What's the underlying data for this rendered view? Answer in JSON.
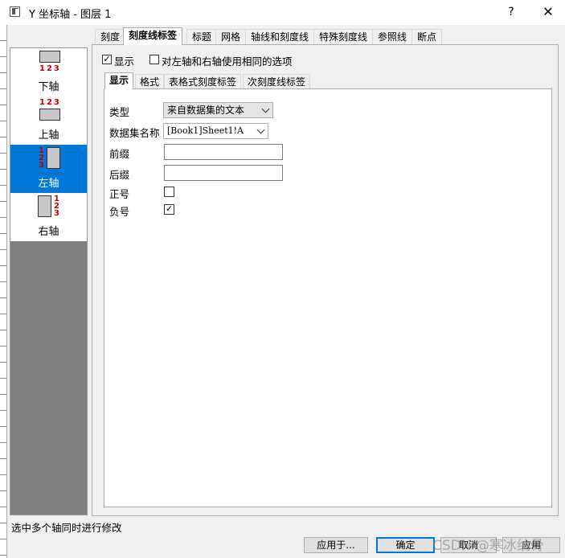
{
  "window": {
    "title": "Y 坐标轴 - 图层 1",
    "help": "?",
    "close": "✕"
  },
  "top_tabs": [
    "刻度",
    "刻度线标签",
    "标题",
    "网格",
    "轴线和刻度线",
    "特殊刻度线",
    "参照线",
    "断点"
  ],
  "axes": [
    {
      "label": "下轴",
      "nums": "123"
    },
    {
      "label": "上轴",
      "nums": "123"
    },
    {
      "label": "左轴",
      "nums": "123",
      "selected": true
    },
    {
      "label": "右轴",
      "nums": "123"
    }
  ],
  "show": {
    "label": "显示",
    "checked": true
  },
  "same_options": {
    "label": "对左轴和右轴使用相同的选项",
    "checked": false
  },
  "inner_tabs": [
    "显示",
    "格式",
    "表格式刻度标签",
    "次刻度线标签"
  ],
  "form": {
    "type_label": "类型",
    "type_value": "来自数据集的文本",
    "dataset_label": "数据集名称",
    "dataset_value": "[Book1]Sheet1!A",
    "prefix_label": "前缀",
    "prefix_value": "",
    "suffix_label": "后缀",
    "suffix_value": "",
    "plus_label": "正号",
    "plus_checked": false,
    "minus_label": "负号",
    "minus_checked": true
  },
  "status_text": "选中多个轴同时进行修改",
  "buttons": {
    "apply_to": "应用于...",
    "ok": "确定",
    "cancel": "取消",
    "apply": "应用"
  },
  "watermark": "CSDN @寒冰纳骨"
}
